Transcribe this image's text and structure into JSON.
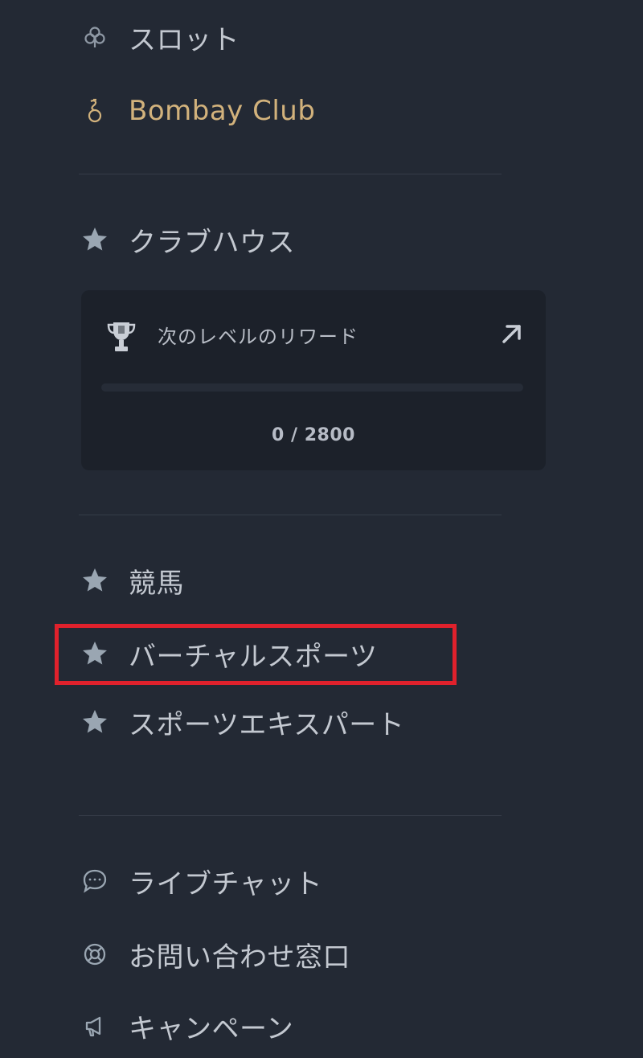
{
  "nav_top": [
    {
      "label": "スロット",
      "icon": "clover-icon"
    },
    {
      "label": "Bombay Club",
      "icon": "bombay-club-icon",
      "color": "#d2b27c"
    }
  ],
  "clubhouse": {
    "label": "クラブハウス",
    "icon": "star-icon",
    "reward_card": {
      "title": "次のレベルのリワード",
      "progress_text": "0 / 2800",
      "progress_current": 0,
      "progress_max": 2800,
      "trophy_icon": "trophy-icon",
      "arrow_icon": "arrow-up-right-icon"
    }
  },
  "nav_middle": [
    {
      "label": "競馬",
      "icon": "star-icon"
    },
    {
      "label": "バーチャルスポーツ",
      "icon": "star-icon",
      "highlighted": true,
      "highlight_color": "#e0212c"
    },
    {
      "label": "スポーツエキスパート",
      "icon": "star-icon"
    }
  ],
  "nav_bottom": [
    {
      "label": "ライブチャット",
      "icon": "chat-bubble-icon"
    },
    {
      "label": "お問い合わせ窓口",
      "icon": "lifebuoy-icon"
    },
    {
      "label": "キャンペーン",
      "icon": "megaphone-icon"
    }
  ],
  "colors": {
    "background": "#232934",
    "card_background": "#1c212a",
    "text": "#c3c8d0",
    "gold": "#d2b27c",
    "icon": "#9aa6b2",
    "highlight": "#e0212c"
  }
}
